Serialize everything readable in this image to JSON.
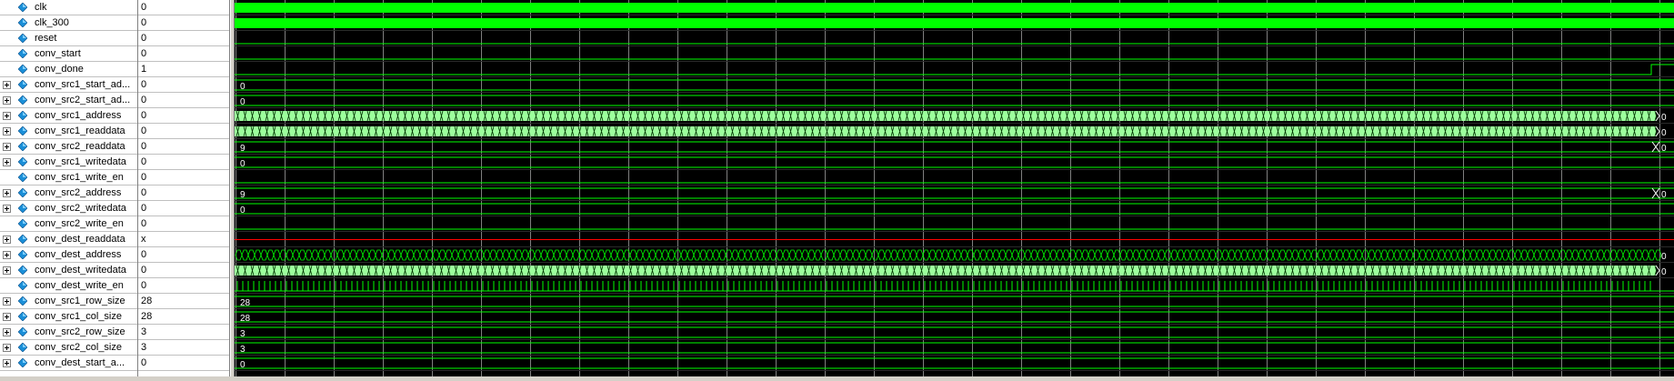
{
  "colors": {
    "wave_high": "#00ff00",
    "wave_bus": "#00ff00",
    "bus_fill": "#9cff9c",
    "wave_x": "#ff0000",
    "grid": "#7f7f7f",
    "background": "#000000"
  },
  "signals": [
    {
      "name": "clk",
      "value": "0",
      "expandable": false,
      "icon": "signal-diamond-icon",
      "kind": "clock",
      "wave_label": ""
    },
    {
      "name": "clk_300",
      "value": "0",
      "expandable": false,
      "icon": "signal-diamond-icon",
      "kind": "clock",
      "wave_label": ""
    },
    {
      "name": "reset",
      "value": "0",
      "expandable": false,
      "icon": "signal-diamond-icon",
      "kind": "low",
      "wave_label": ""
    },
    {
      "name": "conv_start",
      "value": "0",
      "expandable": false,
      "icon": "signal-diamond-icon",
      "kind": "low",
      "wave_label": ""
    },
    {
      "name": "conv_done",
      "value": "1",
      "expandable": false,
      "icon": "signal-diamond-icon",
      "kind": "done",
      "wave_label": ""
    },
    {
      "name": "conv_src1_start_ad...",
      "value": "0",
      "expandable": true,
      "icon": "bus-diamond-icon",
      "kind": "bus",
      "wave_label": "0"
    },
    {
      "name": "conv_src2_start_ad...",
      "value": "0",
      "expandable": true,
      "icon": "bus-diamond-icon",
      "kind": "bus",
      "wave_label": "0"
    },
    {
      "name": "conv_src1_address",
      "value": "0",
      "expandable": true,
      "icon": "bus-diamond-icon",
      "kind": "busdense",
      "wave_label": "0"
    },
    {
      "name": "conv_src1_readdata",
      "value": "0",
      "expandable": true,
      "icon": "bus-diamond-icon",
      "kind": "busdense",
      "wave_label": "0"
    },
    {
      "name": "conv_src2_readdata",
      "value": "0",
      "expandable": true,
      "icon": "bus-diamond-icon",
      "kind": "busend",
      "wave_label": "9",
      "end_label": "0"
    },
    {
      "name": "conv_src1_writedata",
      "value": "0",
      "expandable": true,
      "icon": "bus-diamond-icon",
      "kind": "bus",
      "wave_label": "0"
    },
    {
      "name": "conv_src1_write_en",
      "value": "0",
      "expandable": false,
      "icon": "signal-diamond-icon",
      "kind": "low",
      "wave_label": ""
    },
    {
      "name": "conv_src2_address",
      "value": "0",
      "expandable": true,
      "icon": "bus-diamond-icon",
      "kind": "busend",
      "wave_label": "9",
      "end_label": "0"
    },
    {
      "name": "conv_src2_writedata",
      "value": "0",
      "expandable": true,
      "icon": "bus-diamond-icon",
      "kind": "bus",
      "wave_label": "0"
    },
    {
      "name": "conv_src2_write_en",
      "value": "0",
      "expandable": false,
      "icon": "signal-diamond-icon",
      "kind": "low",
      "wave_label": ""
    },
    {
      "name": "conv_dest_readdata",
      "value": "x",
      "expandable": true,
      "icon": "bus-diamond-icon",
      "kind": "x",
      "wave_label": ""
    },
    {
      "name": "conv_dest_address",
      "value": "0",
      "expandable": true,
      "icon": "bus-diamond-icon",
      "kind": "busbeads",
      "wave_label": "0"
    },
    {
      "name": "conv_dest_writedata",
      "value": "0",
      "expandable": true,
      "icon": "bus-diamond-icon",
      "kind": "busdense",
      "wave_label": "0"
    },
    {
      "name": "conv_dest_write_en",
      "value": "0",
      "expandable": false,
      "icon": "signal-diamond-icon",
      "kind": "pulses",
      "wave_label": ""
    },
    {
      "name": "conv_src1_row_size",
      "value": "28",
      "expandable": true,
      "icon": "bus-diamond-icon",
      "kind": "bus",
      "wave_label": "28"
    },
    {
      "name": "conv_src1_col_size",
      "value": "28",
      "expandable": true,
      "icon": "bus-diamond-icon",
      "kind": "bus",
      "wave_label": "28"
    },
    {
      "name": "conv_src2_row_size",
      "value": "3",
      "expandable": true,
      "icon": "bus-diamond-icon",
      "kind": "bus",
      "wave_label": "3"
    },
    {
      "name": "conv_src2_col_size",
      "value": "3",
      "expandable": true,
      "icon": "bus-diamond-icon",
      "kind": "bus",
      "wave_label": "3"
    },
    {
      "name": "conv_dest_start_a...",
      "value": "0",
      "expandable": true,
      "icon": "bus-diamond-icon",
      "kind": "bus",
      "wave_label": "0"
    }
  ]
}
